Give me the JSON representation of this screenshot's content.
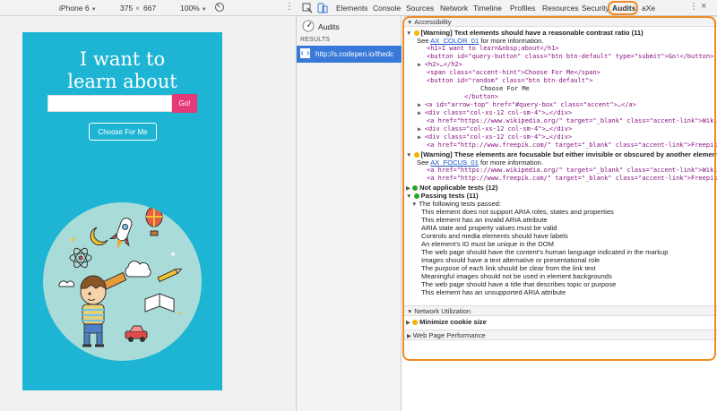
{
  "device_toolbar": {
    "device": "iPhone 6",
    "width": "375",
    "height": "667",
    "zoom": "100%"
  },
  "page": {
    "hero_title_line1": "I want to",
    "hero_title_line2": "learn about",
    "search_value": "",
    "go_label": "Go!",
    "choose_label": "Choose For Me"
  },
  "devtools": {
    "tabs": [
      "Elements",
      "Console",
      "Sources",
      "Network",
      "Timeline",
      "Profiles",
      "Resources",
      "Security",
      "Audits",
      "aXe"
    ],
    "active_tab": "Audits",
    "sidebar": {
      "audits_label": "Audits",
      "results_label": "RESULTS",
      "result_url": "http://s.codepen.io/thedc"
    },
    "accent_color": "#f08a24",
    "selected_color": "#3879d9"
  },
  "audit": {
    "accessibility_header": "Accessibility",
    "warn1_title": "[Warning] Text elements should have a reasonable contrast ratio (11)",
    "warn1_see": "See",
    "warn1_link": "AX_COLOR_01",
    "warn1_more": "for more information.",
    "warn1_lines": [
      "<h1>I want to learn&nbsp;about</h1>",
      "<button id=\"query-button\" class=\"btn btn-default\" type=\"submit\">Go!</button>",
      "<h2>…</h2>",
      "<span class=\"accent-hint\">Choose For Me</span>",
      "<button id=\"random\" class=\"btn btn-default\">",
      "Choose For Me",
      "</button>",
      "<a id=\"arrow-top\" href=\"#query-box\" class=\"accent\">…</a>",
      "<div class=\"col-xs-12 col-sm-4\">…</div>",
      "<a href=\"https://www.wikipedia.org/\" target=\"_blank\" class=\"accent-link\">Wikipedia</a>",
      "<div class=\"col-xs-12 col-sm-4\">…</div>",
      "<div class=\"col-xs-12 col-sm-4\">…</div>",
      "<a href=\"http://www.freepik.com/\" target=\"_blank\" class=\"accent-link\">Freepik</a>"
    ],
    "warn2_title": "[Warning] These elements are focusable but either invisible or obscured by another element",
    "warn2_see": "See",
    "warn2_link": "AX_FOCUS_01",
    "warn2_more": "for more information.",
    "warn2_lines": [
      "<a href=\"https://www.wikipedia.org/\" target=\"_blank\" class=\"accent-link\">Wikipedia</a>",
      "<a href=\"http://www.freepik.com/\" target=\"_blank\" class=\"accent-link\">Freepik</a>"
    ],
    "not_applicable": "Not applicable tests (12)",
    "passing": "Passing tests (11)",
    "passed_header": "The following tests passed:",
    "passed_items": [
      "This element does not support ARIA roles, states and properties",
      "This element has an invalid ARIA attribute",
      "ARIA state and property values must be valid",
      "Controls and media elements should have labels",
      "An element's ID must be unique in the DOM",
      "The web page should have the content's human language indicated in the markup",
      "Images should have a text alternative or presentational role",
      "The purpose of each link should be clear from the link text",
      "Meaningful images should not be used in element backgrounds",
      "The web page should have a title that describes topic or purpose",
      "This element has an unsupported ARIA attribute"
    ],
    "network_header": "Network Utilization",
    "minimize_cookie": "Minimize cookie size",
    "perf_header": "Web Page Performance"
  }
}
